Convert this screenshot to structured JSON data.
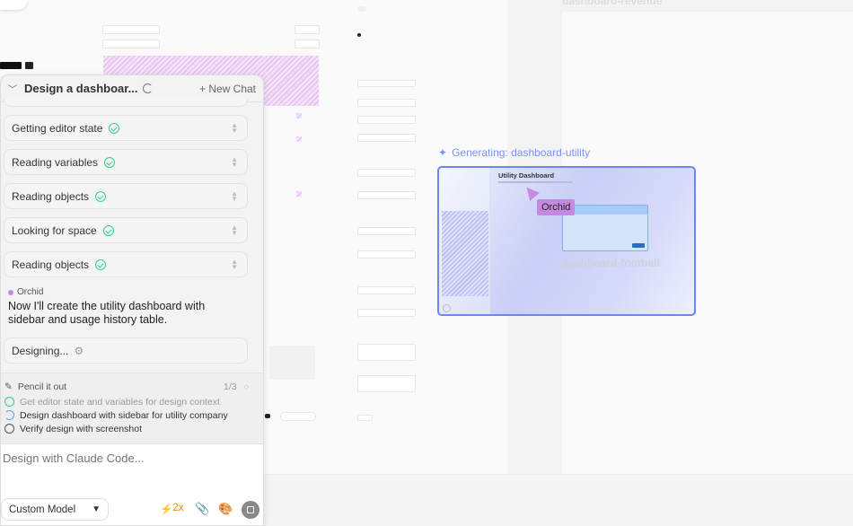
{
  "canvas": {
    "frames": [
      "dashboard-revenue",
      "dashboard-football"
    ],
    "generating_label": "Generating: dashboard-utility",
    "preview": {
      "title": "Utility Dashboard"
    },
    "cursor_label": "Orchid"
  },
  "chat": {
    "title": "Design a dashboar...",
    "new_chat": "New Chat",
    "steps": [
      "Getting editor state",
      "Reading variables",
      "Reading objects",
      "Looking for space",
      "Reading objects"
    ],
    "author": "Orchid",
    "message": "Now I'll create the utility dashboard with sidebar and usage history table.",
    "designing": "Designing...",
    "plan": {
      "title": "Pencil it out",
      "progress": "1/3",
      "items": [
        {
          "text": "Get editor state and variables for design context",
          "status": "done"
        },
        {
          "text": "Design dashboard with sidebar for utility company",
          "status": "in-progress"
        },
        {
          "text": "Verify design with screenshot",
          "status": "pending"
        }
      ]
    },
    "input_placeholder": "Design with Claude Code...",
    "model": "Custom Model",
    "speed": "2x",
    "colors": {
      "accent": "#2fd08a",
      "orchid": "#c58ae0",
      "orange": "#f08a00",
      "blue": "#5b7cf5"
    }
  }
}
